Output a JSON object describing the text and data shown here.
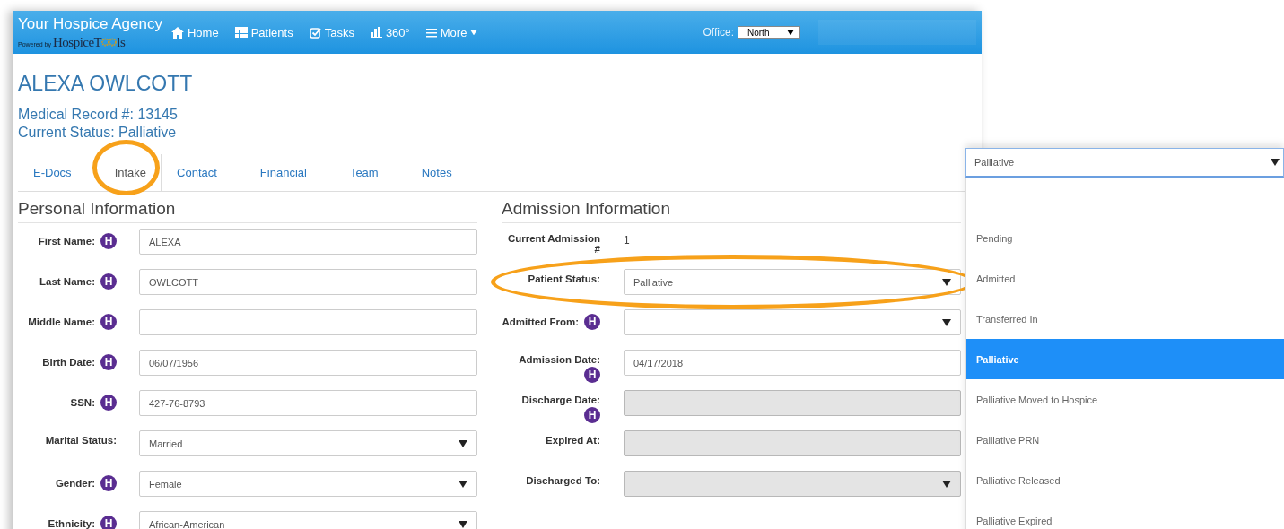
{
  "brand": {
    "title": "Your Hospice Agency",
    "powered_by": "Powered by",
    "logo_a": "HospiceT",
    "logo_c": "ls"
  },
  "nav": [
    {
      "label": "Home",
      "dropdown": false
    },
    {
      "label": "Patients",
      "dropdown": false
    },
    {
      "label": "Tasks",
      "dropdown": false
    },
    {
      "label": "360°",
      "dropdown": false
    },
    {
      "label": "More",
      "dropdown": true
    }
  ],
  "office": {
    "label": "Office:",
    "value": "North"
  },
  "patient": {
    "name": "ALEXA OWLCOTT",
    "record": "Medical Record #: 13145",
    "status": "Current Status: Palliative"
  },
  "tabs": [
    {
      "label": "E-Docs",
      "selected": false,
      "highlighted": false
    },
    {
      "label": "Intake",
      "selected": true,
      "highlighted": true
    },
    {
      "label": "Contact",
      "selected": false,
      "highlighted": false
    },
    {
      "label": "Financial",
      "selected": false,
      "highlighted": false
    },
    {
      "label": "Team",
      "selected": false,
      "highlighted": false
    },
    {
      "label": "Notes",
      "selected": false,
      "highlighted": false
    }
  ],
  "personal": {
    "title": "Personal Information",
    "fields": [
      {
        "label": "First Name:",
        "help": "H",
        "kind": "text",
        "value": "ALEXA",
        "disabled": false
      },
      {
        "label": "Last Name:",
        "help": "H",
        "kind": "text",
        "value": "OWLCOTT",
        "disabled": false
      },
      {
        "label": "Middle Name:",
        "help": "H",
        "kind": "text",
        "disabled": false
      },
      {
        "label": "Birth Date:",
        "help": "H",
        "kind": "text",
        "value": "06/07/1956",
        "disabled": false
      },
      {
        "label": "SSN:",
        "help": "H",
        "kind": "text",
        "value": "427-76-8793",
        "disabled": false
      },
      {
        "label": "Marital Status:",
        "kind": "select",
        "value": "Married",
        "disabled": false
      },
      {
        "label": "Gender:",
        "help": "H",
        "kind": "select",
        "value": "Female",
        "disabled": false
      },
      {
        "label": "Ethnicity:",
        "help": "H",
        "kind": "select",
        "value": "African-American",
        "disabled": false
      }
    ]
  },
  "admission": {
    "title": "Admission Information",
    "fields": [
      {
        "label": "Current Admission #",
        "kind": "static",
        "value": "1"
      },
      {
        "label": "Patient Status:",
        "kind": "select",
        "value": "Palliative",
        "disabled": false,
        "highlighted": true
      },
      {
        "label": "Admitted From:",
        "help": "H",
        "kind": "select",
        "disabled": false
      },
      {
        "label": "Admission Date:",
        "help": "H",
        "kind": "text",
        "value": "04/17/2018",
        "disabled": false
      },
      {
        "label": "Discharge Date:",
        "help": "H",
        "kind": "text",
        "disabled": true
      },
      {
        "label": "Expired At:",
        "kind": "text",
        "disabled": true
      },
      {
        "label": "Discharged To:",
        "kind": "select",
        "disabled": true
      }
    ]
  },
  "status_dropdown": {
    "value": "Palliative",
    "options": [
      {
        "label": "Pending",
        "selected": false
      },
      {
        "label": "Admitted",
        "selected": false
      },
      {
        "label": "Transferred In",
        "selected": false
      },
      {
        "label": "Palliative",
        "selected": true
      },
      {
        "label": "Palliative Moved to Hospice",
        "selected": false
      },
      {
        "label": "Palliative PRN",
        "selected": false
      },
      {
        "label": "Palliative Released",
        "selected": false
      },
      {
        "label": "Palliative Expired",
        "selected": false
      }
    ]
  }
}
